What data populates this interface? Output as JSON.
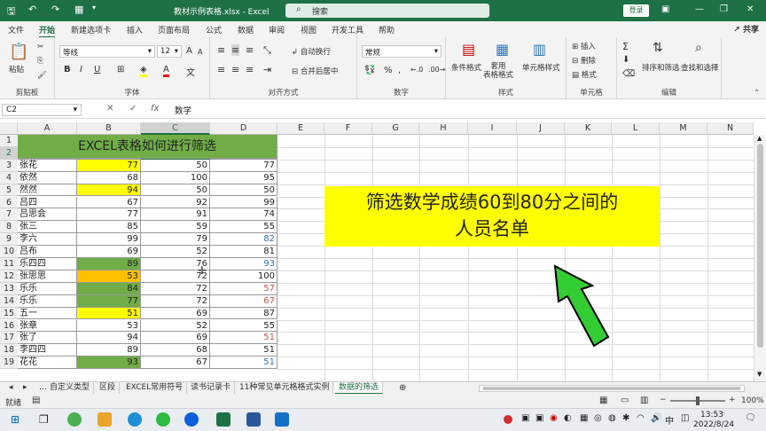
{
  "window": {
    "title": "教材示例表格.xlsx  -  Excel",
    "search_placeholder": "搜索",
    "login_label": "登录"
  },
  "tabs": [
    "文件",
    "开始",
    "插入",
    "页面布局",
    "公式",
    "数据",
    "审阅",
    "视图",
    "开发工具",
    "帮助"
  ],
  "newtab_label": "新建选项卡",
  "share_label": "共享",
  "ribbon": {
    "clipboard": {
      "label": "剪贴板",
      "paste": "粘贴"
    },
    "font": {
      "label": "字体",
      "name": "等线",
      "size": "12",
      "bold": "B",
      "italic": "I",
      "underline": "U",
      "grow": "A",
      "shrink": "A"
    },
    "align": {
      "label": "对齐方式",
      "wrap": "自动换行",
      "merge": "合并后居中"
    },
    "number": {
      "label": "数字",
      "format": "常规"
    },
    "styles": {
      "label": "样式",
      "cond": "条件格式",
      "table": "套用\n表格格式",
      "cellstyle": "单元格样式"
    },
    "cells": {
      "label": "单元格",
      "insert": "插入",
      "delete": "删除",
      "format": "格式"
    },
    "edit": {
      "label": "编辑",
      "sort": "排序和筛选",
      "find": "查找和选择"
    }
  },
  "formula": {
    "cellref": "C2",
    "content": "数学"
  },
  "columns": [
    "A",
    "B",
    "C",
    "D",
    "E",
    "F",
    "G",
    "H",
    "I",
    "J",
    "K",
    "L",
    "M",
    "N"
  ],
  "rows": [
    "1",
    "2",
    "3",
    "4",
    "5",
    "6",
    "7",
    "8",
    "9",
    "10",
    "11",
    "12",
    "13",
    "14",
    "15",
    "16",
    "17",
    "18",
    "19"
  ],
  "sheet": {
    "title": "EXCEL表格如何进行筛选",
    "headers": [
      "姓名",
      "语文",
      "数学",
      "英语"
    ],
    "data": [
      [
        "张花",
        "77",
        "50",
        "77"
      ],
      [
        "依然",
        "68",
        "100",
        "95"
      ],
      [
        "然然",
        "94",
        "50",
        "50"
      ],
      [
        "吕四",
        "67",
        "92",
        "99"
      ],
      [
        "吕思会",
        "77",
        "91",
        "74"
      ],
      [
        "张三",
        "85",
        "59",
        "55"
      ],
      [
        "李六",
        "99",
        "79",
        "82"
      ],
      [
        "吕布",
        "69",
        "52",
        "81"
      ],
      [
        "乐四四",
        "89",
        "76",
        "93"
      ],
      [
        "张思思",
        "53",
        "72",
        "100"
      ],
      [
        "乐乐",
        "84",
        "72",
        "57"
      ],
      [
        "乐乐",
        "77",
        "72",
        "67"
      ],
      [
        "五一",
        "51",
        "69",
        "87"
      ],
      [
        "张章",
        "53",
        "52",
        "55"
      ],
      [
        "张了",
        "94",
        "69",
        "51"
      ],
      [
        "李四四",
        "89",
        "68",
        "51"
      ],
      [
        "花花",
        "93",
        "67",
        "51"
      ]
    ],
    "b_colors": [
      "#ffff00",
      "",
      "#ffff00",
      "",
      "",
      "",
      "",
      "",
      "#70ad47",
      "#ffc000",
      "#70ad47",
      "#70ad47",
      "#ffff00",
      "",
      "",
      "",
      "#70ad47"
    ],
    "d_colors": [
      "",
      "",
      "",
      "",
      "",
      "",
      "#2e75b6",
      "",
      "#2e75b6",
      "",
      "#c0504d",
      "#c0504d",
      "",
      "",
      "#c0504d",
      "",
      "#2e75b6"
    ]
  },
  "annotation": "筛选数学成绩60到80分之间的人员名单",
  "annotation_lines": [
    "筛选数学成绩60到80分之间的",
    "人员名单"
  ],
  "sheet_tabs": [
    "自定义类型",
    "区段",
    "EXCEL常用符号",
    "读书记录卡",
    "11种常见单元格格式实例",
    "数据的筛选"
  ],
  "status": {
    "ready": "就绪",
    "zoom": "100%"
  },
  "taskbar": {
    "time": "13:53",
    "date": "2022/8/24",
    "ime": "中"
  }
}
